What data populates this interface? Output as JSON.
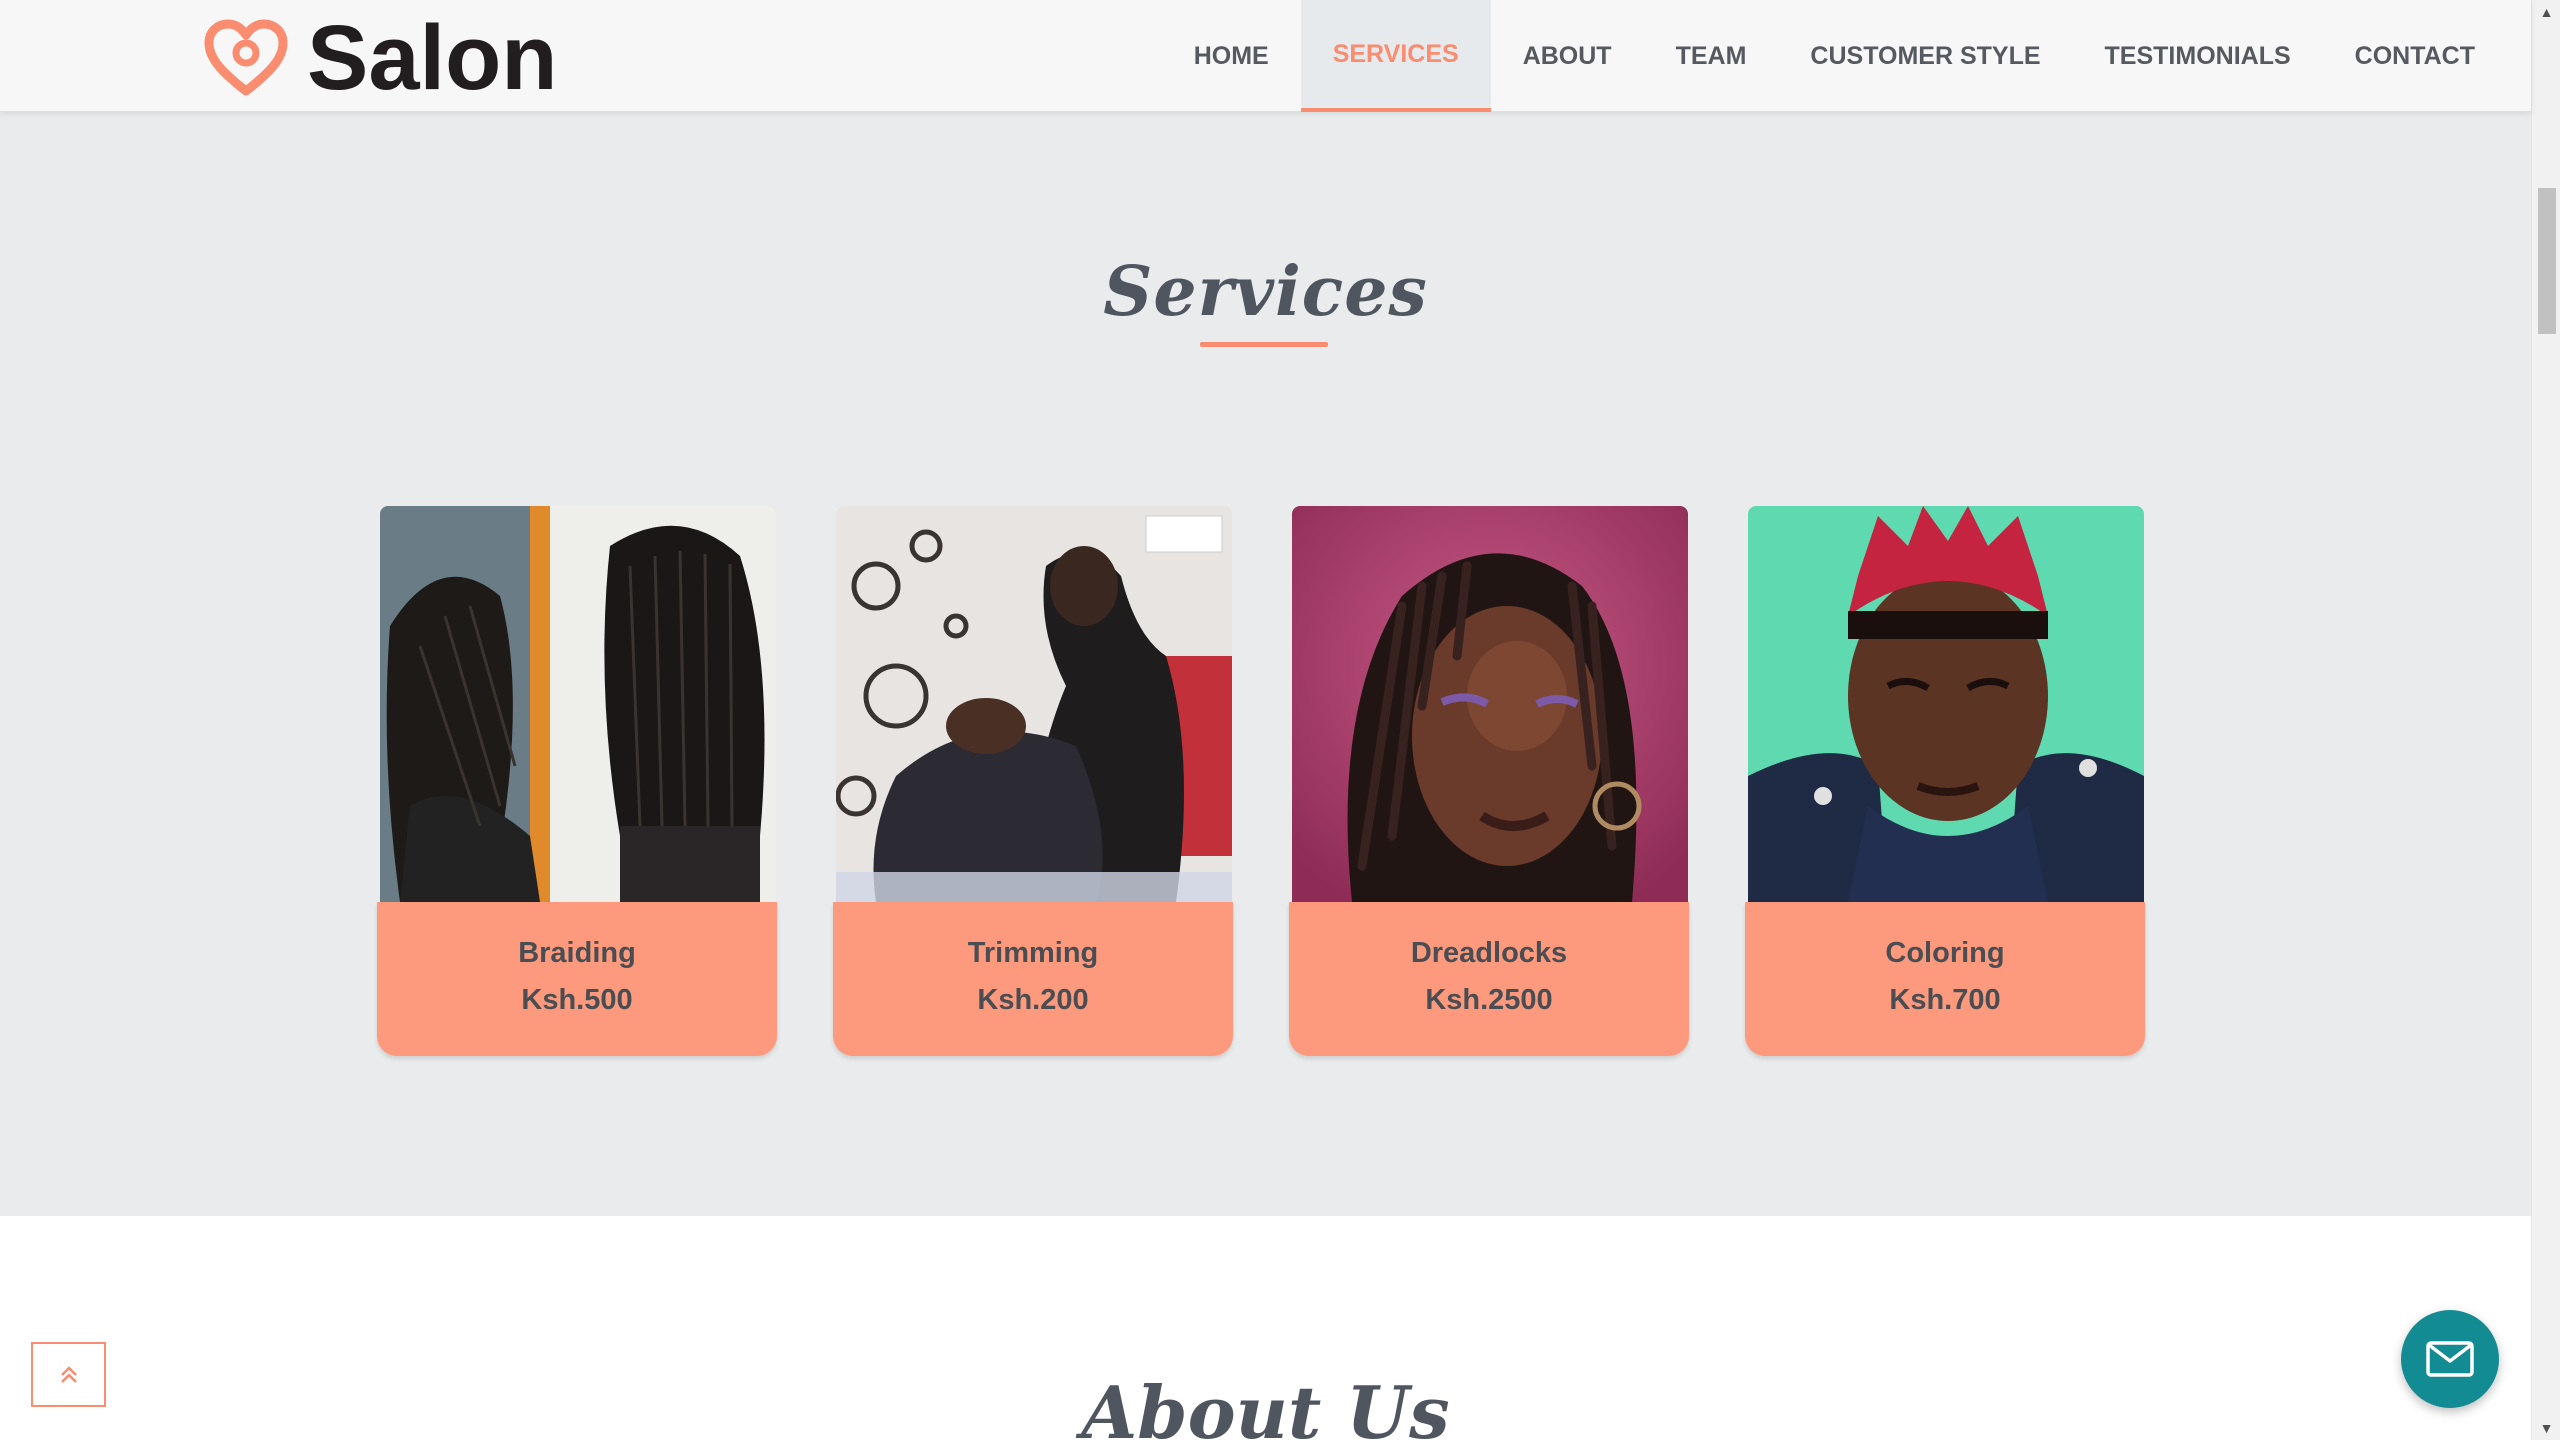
{
  "brand": {
    "name": "Salon",
    "icon": "heart-logo-icon",
    "accent": "#fa8c6f"
  },
  "nav": {
    "items": [
      "HOME",
      "SERVICES",
      "ABOUT",
      "TEAM",
      "CUSTOMER STYLE",
      "TESTIMONIALS",
      "CONTACT"
    ],
    "active": "SERVICES"
  },
  "services": {
    "title": "Services",
    "cards": [
      {
        "name": "Braiding",
        "price": "Ksh.500",
        "photo": "braided-hair-photo"
      },
      {
        "name": "Trimming",
        "price": "Ksh.200",
        "photo": "barber-trimming-photo"
      },
      {
        "name": "Dreadlocks",
        "price": "Ksh.2500",
        "photo": "dreadlocks-photo"
      },
      {
        "name": "Coloring",
        "price": "Ksh.700",
        "photo": "colored-hair-photo"
      }
    ]
  },
  "about": {
    "title": "About Us"
  },
  "widgets": {
    "back_to_top_icon": "double-chevron-up-icon",
    "mail_icon": "envelope-icon",
    "mail_color": "#138b93"
  },
  "colors": {
    "card_bg": "#fd9a7d",
    "section_bg": "#e9ebed",
    "nav_active": "#fa8c6f"
  }
}
